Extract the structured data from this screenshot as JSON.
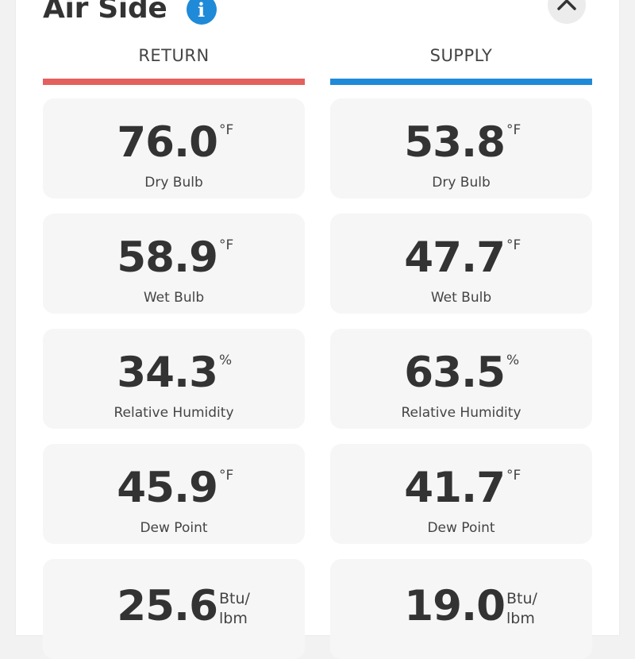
{
  "section": {
    "title": "Air Side",
    "info_icon": "info-icon",
    "collapse_icon": "chevron-up-icon"
  },
  "colors": {
    "return_accent": "#e4605e",
    "supply_accent": "#1f8ad8"
  },
  "return": {
    "heading": "RETURN",
    "metrics": [
      {
        "value": "76.0",
        "unit": "°F",
        "label": "Dry Bulb"
      },
      {
        "value": "58.9",
        "unit": "°F",
        "label": "Wet Bulb"
      },
      {
        "value": "34.3",
        "unit": "%",
        "label": "Relative Humidity"
      },
      {
        "value": "45.9",
        "unit": "°F",
        "label": "Dew Point"
      },
      {
        "value": "25.6",
        "unit": "Btu/ lbm",
        "label": ""
      }
    ]
  },
  "supply": {
    "heading": "SUPPLY",
    "metrics": [
      {
        "value": "53.8",
        "unit": "°F",
        "label": "Dry Bulb"
      },
      {
        "value": "47.7",
        "unit": "°F",
        "label": "Wet Bulb"
      },
      {
        "value": "63.5",
        "unit": "%",
        "label": "Relative Humidity"
      },
      {
        "value": "41.7",
        "unit": "°F",
        "label": "Dew Point"
      },
      {
        "value": "19.0",
        "unit": "Btu/ lbm",
        "label": ""
      }
    ]
  }
}
